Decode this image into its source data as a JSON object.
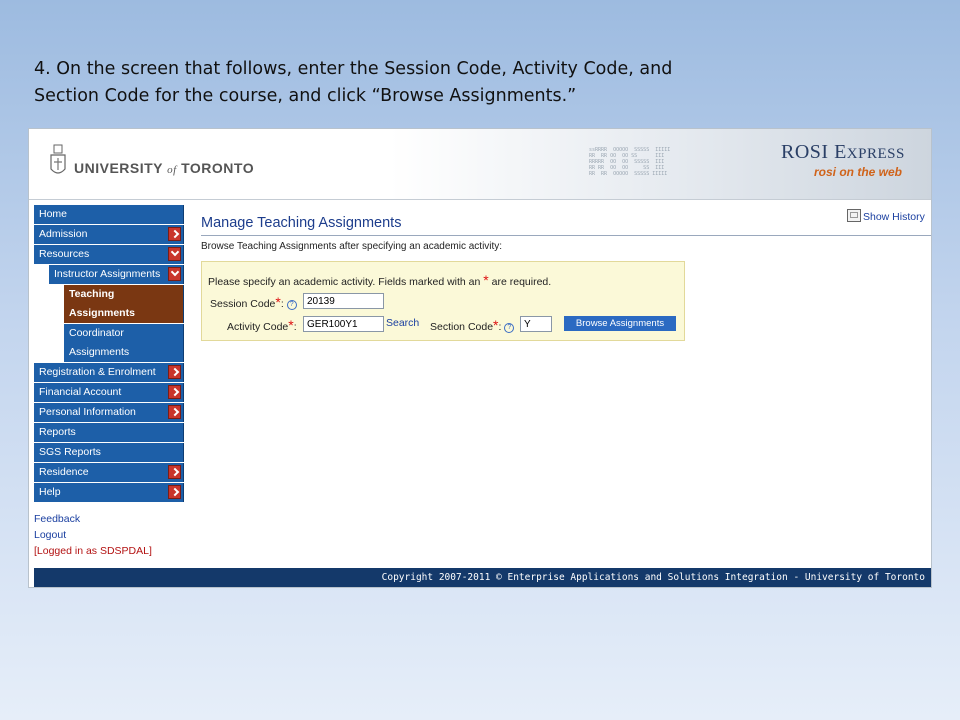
{
  "instruction": {
    "line1": "4. On the screen that follows, enter the Session Code, Activity Code, and",
    "line2": "Section Code for the course, and click “Browse Assignments.”"
  },
  "header": {
    "university": "UNIVERSITY",
    "university_of": "of",
    "university_city": "TORONTO",
    "app_title_main": "ROSI E",
    "app_title_small": "XPRESS",
    "app_subtitle": "rosi on the web"
  },
  "nav": {
    "home": "Home",
    "admission": "Admission",
    "resources": "Resources",
    "instructor_assignments": "Instructor Assignments",
    "teaching_assignments_1": "Teaching",
    "teaching_assignments_2": "Assignments",
    "coordinator_assignments_1": "Coordinator",
    "coordinator_assignments_2": "Assignments",
    "registration": "Registration & Enrolment",
    "financial": "Financial Account",
    "personal": "Personal Information",
    "reports": "Reports",
    "sgs_reports": "SGS Reports",
    "residence": "Residence",
    "help": "Help",
    "feedback": "Feedback",
    "logout": "Logout",
    "logged_in": "[Logged in as SDSPDAL]"
  },
  "main": {
    "title": "Manage Teaching Assignments",
    "show_history": "Show History",
    "subtitle": "Browse Teaching Assignments after specifying an academic activity:",
    "panel_prompt_a": "Please specify an academic activity. Fields marked with an",
    "panel_prompt_star": "*",
    "panel_prompt_b": "are required.",
    "session_label": "Session Code",
    "session_value": "20139",
    "activity_label": "Activity Code",
    "activity_value": "GER100Y1",
    "search_link": "Search",
    "section_label": "Section Code",
    "section_value": "Y",
    "browse_button": "Browse Assignments",
    "required_mark": "*",
    "colon": ":",
    "help_glyph": "?"
  },
  "footer": {
    "copyright": "Copyright 2007-2011 © Enterprise Applications and Solutions Integration - University of Toronto"
  }
}
